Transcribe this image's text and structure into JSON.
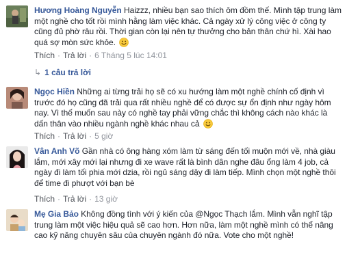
{
  "comments": [
    {
      "author": "Hương Hoàng Nguyễn",
      "text": "Haizzz, nhiều bạn sao thích ôm đồm thế. Mình tập trung làm một nghề cho tốt rồi mình hằng làm việc khác. Cả ngày xử lý công việc ở công ty cũng đủ phờ râu rồi. Thời gian còn lại nên tự thưởng cho bản thân chứ hì. Xài hao quá sợ mòn sức khỏe.",
      "like_label": "Thích",
      "reply_label": "Trả lời",
      "timestamp": "6 Tháng 5 lúc 14:01",
      "replies_label": "1 câu trả lời",
      "emoji": "smiley-emoji"
    },
    {
      "author": "Ngọc Hiền",
      "text": "Những ai từng trải họ sẽ có xu hướng làm một nghề chính cố định vì trước đó họ cũng đã trải qua rất nhiều nghề để có được sự ổn định như ngày hôm nay. Vì thế muốn sau này có nghề tay phải vững chắc thì không cách nào khác là dấn thân vào nhiều ngành nghề khác nhau cả",
      "like_label": "Thích",
      "reply_label": "Trả lời",
      "timestamp": "5 giờ",
      "emoji": "smiley-emoji"
    },
    {
      "author": "Vân Anh Võ",
      "text": "Gần nhà có ông hàng xóm làm từ sáng đến tối muộn mới về, nhà giàu lắm, mới xây mới lại nhưng đi xe wave rất là bình dân nghe đâu ổng làm 4 job, cả ngày đi làm tối phia mới dzia, rồi ngủ sáng dậy đi làm tiếp. Mình chọn một nghề thôi để time đi phượt với bạn bè",
      "like_label": "Thích",
      "reply_label": "Trả lời",
      "timestamp": "13 giờ"
    },
    {
      "author": "Mẹ Gia Bảo",
      "text": "Không đồng tình với ý kiến của @Ngọc Thạch lắm. Mình vẫn nghĩ tập trung làm một việc hiệu quả sẽ cao hơn. Hơn nữa, làm một nghề mình có thể nâng cao kỹ năng chuyên sâu của chuyên ngành đó nữa. Vote cho một nghề!"
    }
  ],
  "colors": {
    "author": "#365899",
    "text": "#1d2129",
    "meta": "#90949c"
  }
}
